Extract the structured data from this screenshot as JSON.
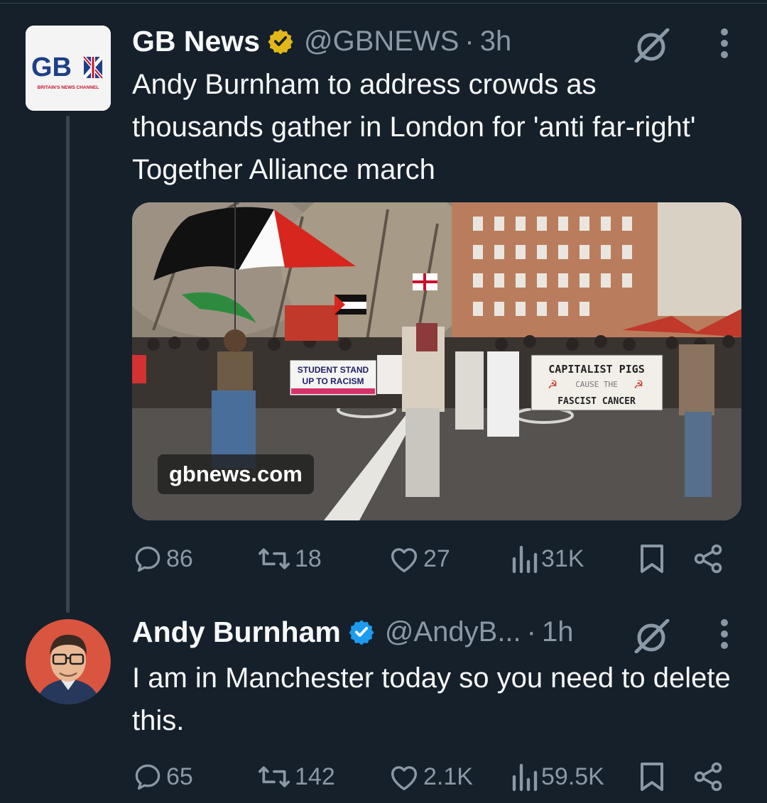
{
  "tweets": [
    {
      "author": {
        "name": "GB News",
        "handle": "@GBNEWS",
        "verified": "gold",
        "avatar_logo": "GBN",
        "avatar_tagline": "BRITAIN'S NEWS CHANNEL"
      },
      "time": "3h",
      "text": "Andy Burnham to address crowds as thousands gather in London for 'anti far-right' Together Alliance march",
      "media": {
        "source_badge": "gbnews.com",
        "banners": [
          "STUDENT STAND UP TO RACISM",
          "CAPITALIST PIGS",
          "CAUSE THE",
          "FASCIST CANCER"
        ]
      },
      "stats": {
        "replies": "86",
        "reposts": "18",
        "likes": "27",
        "views": "31K"
      }
    },
    {
      "author": {
        "name": "Andy Burnham",
        "handle": "@AndyB...",
        "verified": "blue"
      },
      "time": "1h",
      "text": "I am in Manchester today so you need to delete this.",
      "stats": {
        "replies": "65",
        "reposts": "142",
        "likes": "2.1K",
        "views": "59.5K"
      }
    }
  ],
  "icons": [
    "verified-gold-icon",
    "verified-blue-icon",
    "grok-icon",
    "more-icon",
    "reply-icon",
    "repost-icon",
    "like-icon",
    "views-icon",
    "bookmark-icon",
    "share-icon"
  ],
  "colors": {
    "background": "#15202b",
    "text": "#f7f9f9",
    "muted": "#8b98a5",
    "verified_gold": "#e2b719",
    "verified_blue": "#1d9bf0"
  }
}
